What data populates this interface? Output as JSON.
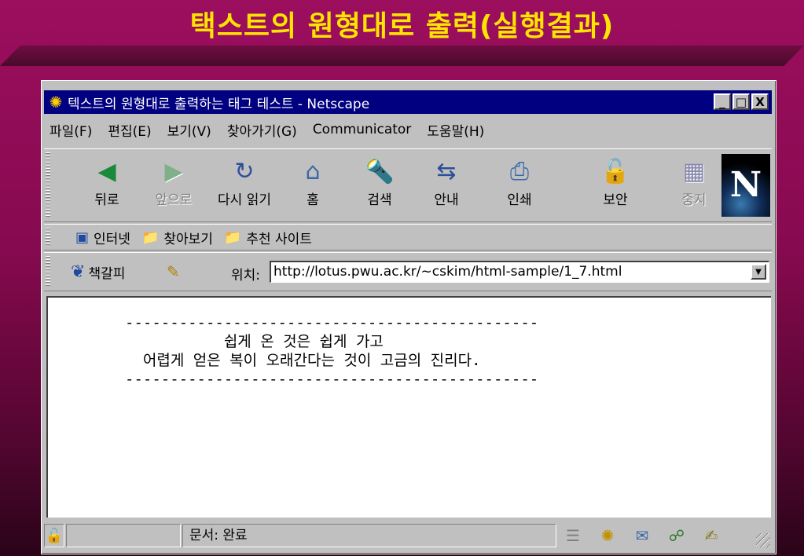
{
  "slide": {
    "title": "택스트의 원형대로 출력(실행결과)"
  },
  "window": {
    "title": "텍스트의 원형대로 출력하는 태그 테스트 - Netscape",
    "controls": {
      "minimize": "_",
      "maximize": "□",
      "close": "X"
    }
  },
  "menu": [
    "파일(F)",
    "편집(E)",
    "보기(V)",
    "찾아가기(G)",
    "Communicator",
    "도움말(H)"
  ],
  "nav_toolbar": {
    "buttons": [
      {
        "label": "뒤로",
        "icon": "back-arrow-icon",
        "glyph": "◀"
      },
      {
        "label": "앞으로",
        "icon": "forward-arrow-icon",
        "glyph": "▶"
      },
      {
        "label": "다시 읽기",
        "icon": "reload-icon",
        "glyph": "↻"
      },
      {
        "label": "홈",
        "icon": "home-icon",
        "glyph": "⌂"
      },
      {
        "label": "검색",
        "icon": "search-icon",
        "glyph": "🔦"
      },
      {
        "label": "안내",
        "icon": "guide-icon",
        "glyph": "⇆"
      },
      {
        "label": "인쇄",
        "icon": "print-icon",
        "glyph": "⎙"
      },
      {
        "label": "보안",
        "icon": "security-icon",
        "glyph": "🔓"
      },
      {
        "label": "중지",
        "icon": "stop-icon",
        "glyph": "▦"
      }
    ],
    "logo": "N"
  },
  "personal_toolbar": {
    "items": [
      {
        "label": "인터넷",
        "glyph": "▣"
      },
      {
        "label": "찾아보기",
        "glyph": "📁"
      },
      {
        "label": "추천 사이트",
        "glyph": "📁"
      }
    ]
  },
  "location_toolbar": {
    "bookmark_label": "책갈피",
    "location_label": "위치:",
    "url": "http://lotus.pwu.ac.kr/~cskim/html-sample/1_7.html"
  },
  "content": {
    "preformatted": "----------------------------------------------\n           쉽게 온 것은 쉽게 가고\n  어렵게 얻은 복이 오래간다는 것이 고금의 진리다.\n----------------------------------------------"
  },
  "statusbar": {
    "text": "문서: 완료"
  }
}
